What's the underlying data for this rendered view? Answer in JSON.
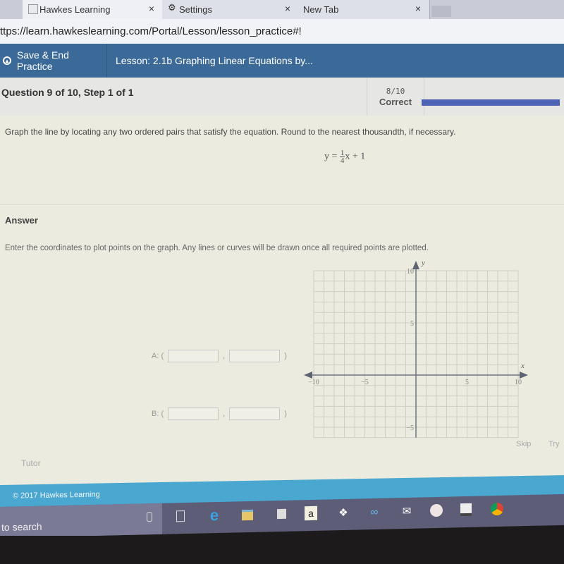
{
  "browser": {
    "tabs": [
      {
        "title": "Hawkes Learning",
        "active": true
      },
      {
        "title": "Settings",
        "active": false
      },
      {
        "title": "New Tab",
        "active": false
      }
    ],
    "close_glyph": "×",
    "url": "ttps://learn.hawkeslearning.com/Portal/Lesson/lesson_practice#!"
  },
  "nav": {
    "save_label": "Save & End Practice",
    "lesson_title": "Lesson: 2.1b Graphing Linear Equations by..."
  },
  "question": {
    "title": "Question 9 of 10,  Step 1 of 1",
    "score_fraction": "8/10",
    "score_label": "Correct",
    "progress_fraction": 1.0,
    "instruction": "Graph the line by locating any two ordered pairs that satisfy the equation. Round to the nearest thousandth, if necessary.",
    "equation": {
      "lhs": "y =",
      "numerator": "1",
      "denominator": "4",
      "rhs": "x + 1"
    }
  },
  "answer": {
    "heading": "Answer",
    "instruction": "Enter the coordinates to plot points on the graph. Any lines or curves will be drawn once all required points are plotted.",
    "points": [
      {
        "label": "A: (",
        "x_value": "",
        "y_value": "",
        "comma": ",",
        "close": ")"
      },
      {
        "label": "B: (",
        "x_value": "",
        "y_value": "",
        "comma": ",",
        "close": ")"
      }
    ]
  },
  "graph": {
    "x_axis_label": "x",
    "y_axis_label": "y",
    "x_range": [
      -10,
      10
    ],
    "y_range": [
      -6,
      10
    ],
    "x_tick_labels": [
      "−10",
      "−5",
      "5",
      "10"
    ],
    "y_tick_labels": [
      "10",
      "5",
      "−5"
    ]
  },
  "actions": {
    "skip": "Skip",
    "try": "Try",
    "tutor": "Tutor"
  },
  "footer": {
    "copyright": "© 2017 Hawkes Learning"
  },
  "taskbar": {
    "search_text": "to search",
    "icons": [
      "microphone-icon",
      "task-view-icon",
      "edge-icon",
      "file-explorer-icon",
      "store-icon",
      "amazon-icon",
      "dropbox-icon",
      "infinity-icon",
      "mail-icon",
      "itunes-icon",
      "photos-icon",
      "chrome-icon"
    ],
    "amazon_glyph": "a"
  }
}
